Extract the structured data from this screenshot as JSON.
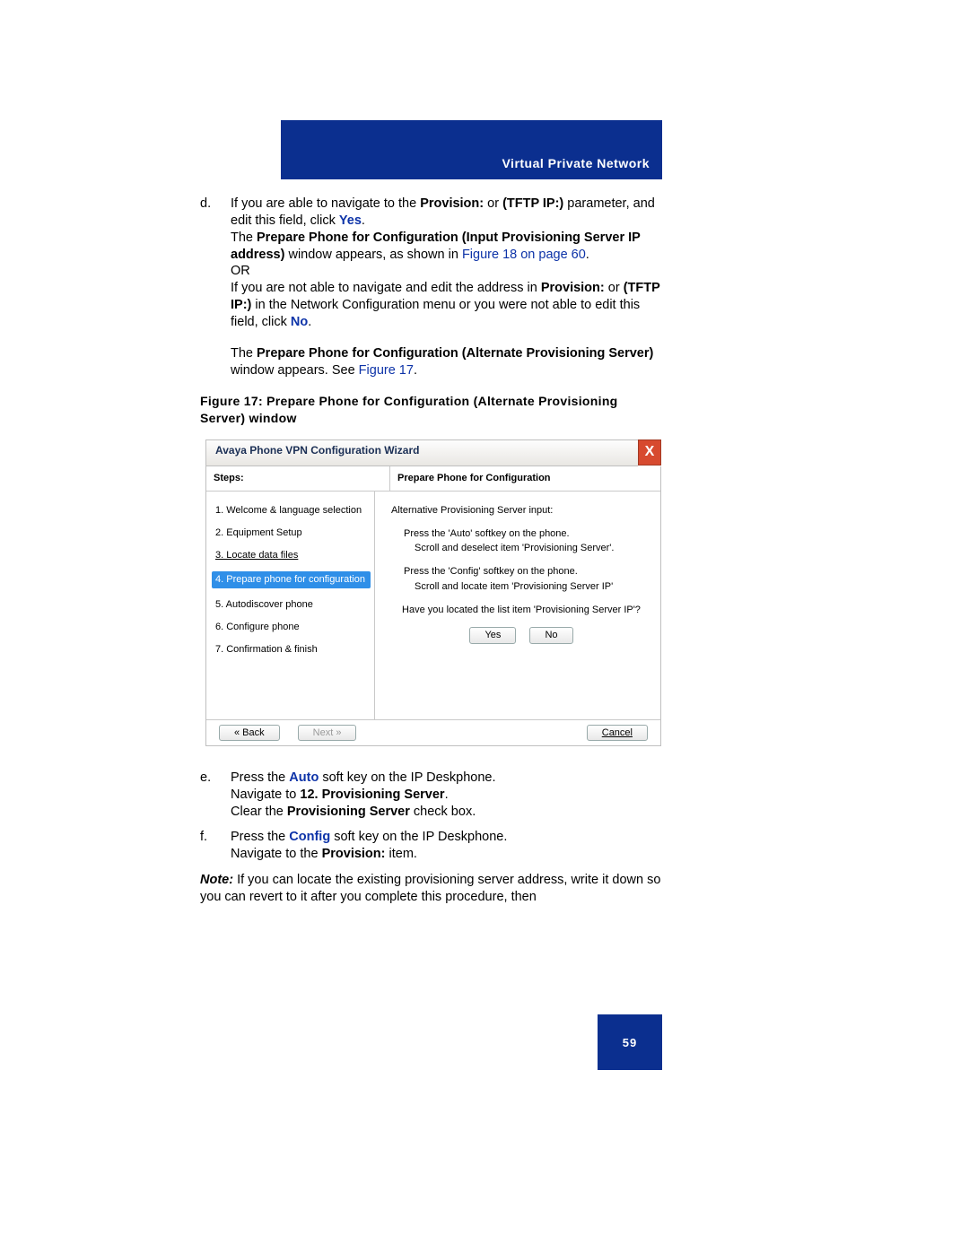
{
  "header": {
    "title": "Virtual Private Network"
  },
  "body": {
    "d_marker": "d.",
    "d_line1a": "If you are able to navigate to the ",
    "d_line1b": "Provision:",
    "d_line1c": " or ",
    "d_line1d": "(TFTP IP:)",
    "d_line1e": " parameter, and edit this field, click ",
    "d_yes": "Yes",
    "d_period1": ".",
    "d_line2a": "The ",
    "d_line2b": "Prepare Phone for Configuration (Input Provisioning Server IP address)",
    "d_line2c": " window appears, as shown in ",
    "d_figlink": "Figure 18 on page 60",
    "d_period2": ".",
    "d_or": "OR",
    "d_line3a": "If you are not able to navigate and edit the address in ",
    "d_line3b": "Provision:",
    "d_line3c": " or ",
    "d_line3d": "(TFTP IP:)",
    "d_line3e": " in the Network Configuration menu or you were not able to edit this field, click ",
    "d_no": "No",
    "d_period3": ".",
    "para2a": "The ",
    "para2b": "Prepare Phone for Configuration (Alternate Provisioning Server)",
    "para2c": " window appears. See ",
    "para2link": "Figure 17",
    "para2period": ".",
    "fig_caption": "Figure 17: Prepare Phone for Configuration (Alternate Provisioning Server) window",
    "e_marker": "e.",
    "e_line1a": "Press the ",
    "e_auto": "Auto",
    "e_line1b": " soft key on the IP Deskphone.",
    "e_line2a": "Navigate to ",
    "e_line2b": "12. Provisioning Server",
    "e_line2period": ".",
    "e_line3a": "Clear the ",
    "e_line3b": "Provisioning Server",
    "e_line3c": " check box.",
    "f_marker": "f.",
    "f_line1a": "Press the ",
    "f_config": "Config",
    "f_line1b": " soft key on the IP Deskphone.",
    "f_line2a": "Navigate to the ",
    "f_line2b": "Provision:",
    "f_line2c": " item.",
    "note_label": "Note:",
    "note_text": " If you can locate the existing provisioning server address, write it down so you can revert to it after you complete this procedure, then"
  },
  "wizard": {
    "title": "Avaya Phone VPN Configuration Wizard",
    "close": "X",
    "steps_header": "Steps:",
    "right_header": "Prepare Phone for Configuration",
    "steps": [
      "1. Welcome & language selection",
      "2. Equipment Setup",
      "3. Locate data files",
      "4. Prepare phone for configuration",
      "5. Autodiscover phone",
      "6. Configure phone",
      "7. Confirmation & finish"
    ],
    "right": {
      "l1": "Alternative Provisioning Server input:",
      "l2": "Press the 'Auto' softkey on the phone.",
      "l3": "Scroll and deselect item 'Provisioning Server'.",
      "l4": "Press the 'Config' softkey on the phone.",
      "l5": "Scroll and locate item 'Provisioning Server IP'",
      "l6": "Have you located the list item 'Provisioning Server IP'?",
      "yes": "Yes",
      "no": "No"
    },
    "footer": {
      "back": "« Back",
      "next": "Next  »",
      "cancel": "Cancel"
    }
  },
  "footer": {
    "page": "59"
  }
}
